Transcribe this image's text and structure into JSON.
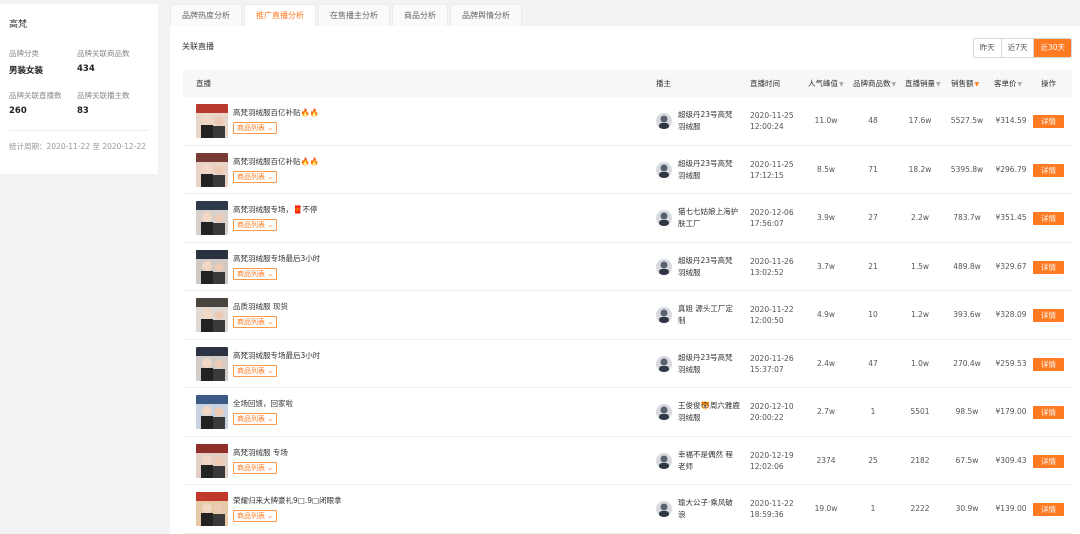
{
  "brand": {
    "name": "高梵",
    "stats": [
      {
        "label": "品牌分类",
        "value": "男装女装"
      },
      {
        "label": "品牌关联商品数",
        "value": "434"
      },
      {
        "label": "品牌关联直播数",
        "value": "260"
      },
      {
        "label": "品牌关联播主数",
        "value": "83"
      }
    ],
    "period": "统计周期：2020-11-22 至 2020-12-22"
  },
  "tabs": [
    "品牌热度分析",
    "推广直播分析",
    "在售播主分析",
    "商品分析",
    "品牌舆情分析"
  ],
  "active_tab": 1,
  "section_title": "关联直播",
  "ranges": [
    "昨天",
    "近7天",
    "近30天"
  ],
  "active_range": 2,
  "columns": {
    "live": "直播",
    "anchor": "播主",
    "time": "直播时间",
    "popularity": "人气峰值",
    "brand_goods": "品牌商品数",
    "live_sales": "直播销量",
    "revenue": "销售额",
    "unit_price": "客单价",
    "action": "操作"
  },
  "goods_list_label": "商品列表",
  "detail_label": "详情",
  "colors": {
    "accent": "#ff7a21"
  },
  "rows": [
    {
      "title": "高梵羽绒服百亿补贴🔥🔥",
      "anchor": "超级丹23号高梵羽绒服",
      "time": "2020-11-25 12:00:24",
      "popularity": "11.0w",
      "brand_goods": "48",
      "live_sales": "17.6w",
      "revenue": "5527.5w",
      "unit_price": "¥314.59"
    },
    {
      "title": "高梵羽绒服百亿补贴🔥🔥",
      "anchor": "超级丹23号高梵羽绒服",
      "time": "2020-11-25 17:12:15",
      "popularity": "8.5w",
      "brand_goods": "71",
      "live_sales": "18.2w",
      "revenue": "5395.8w",
      "unit_price": "¥296.79"
    },
    {
      "title": "高梵羽绒服专场，🧧不停",
      "anchor": "猫七七姑娘上海护肤工厂",
      "time": "2020-12-06 17:56:07",
      "popularity": "3.9w",
      "brand_goods": "27",
      "live_sales": "2.2w",
      "revenue": "783.7w",
      "unit_price": "¥351.45"
    },
    {
      "title": "高梵羽绒服专场最后3小时",
      "anchor": "超级丹23号高梵羽绒服",
      "time": "2020-11-26 13:02:52",
      "popularity": "3.7w",
      "brand_goods": "21",
      "live_sales": "1.5w",
      "revenue": "489.8w",
      "unit_price": "¥329.67"
    },
    {
      "title": "品质羽绒服 现货",
      "anchor": "真姐 源头工厂定制",
      "time": "2020-11-22 12:00:50",
      "popularity": "4.9w",
      "brand_goods": "10",
      "live_sales": "1.2w",
      "revenue": "393.6w",
      "unit_price": "¥328.09"
    },
    {
      "title": "高梵羽绒服专场最后3小时",
      "anchor": "超级丹23号高梵羽绒服",
      "time": "2020-11-26 15:37:07",
      "popularity": "2.4w",
      "brand_goods": "47",
      "live_sales": "1.0w",
      "revenue": "270.4w",
      "unit_price": "¥259.53"
    },
    {
      "title": "全场回馈，回家啦",
      "anchor": "王俊俊🐯周六雅鹿羽绒服",
      "time": "2020-12-10 20:00:22",
      "popularity": "2.7w",
      "brand_goods": "1",
      "live_sales": "5501",
      "revenue": "98.5w",
      "unit_price": "¥179.00"
    },
    {
      "title": "高梵羽绒服 专场",
      "anchor": "幸福不是偶然 程老师",
      "time": "2020-12-19 12:02:06",
      "popularity": "2374",
      "brand_goods": "25",
      "live_sales": "2182",
      "revenue": "67.5w",
      "unit_price": "¥309.43"
    },
    {
      "title": "荣耀归来大牌豪礼9□.9□闭眼拿",
      "anchor": "瑜大公子·乘风破浪",
      "time": "2020-11-22 18:59:36",
      "popularity": "19.0w",
      "brand_goods": "1",
      "live_sales": "2222",
      "revenue": "30.9w",
      "unit_price": "¥139.00"
    }
  ]
}
